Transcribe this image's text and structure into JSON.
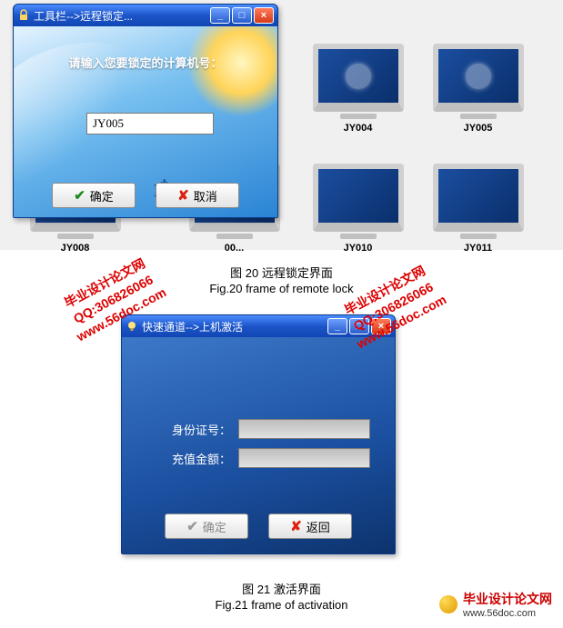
{
  "dialog1": {
    "title": "工具栏-->远程锁定...",
    "prompt": "请输入您要锁定的计算机号：",
    "input_value": "JY005",
    "ok_label": "确定",
    "cancel_label": "取消"
  },
  "dialog2": {
    "title": "快速通道-->上机激活",
    "id_label": "身份证号：",
    "amount_label": "充值金额：",
    "id_value": "",
    "amount_value": "",
    "ok_label": "确定",
    "back_label": "返回"
  },
  "desktop": {
    "pc_09": "JY004",
    "pc_10": "JY005",
    "pc_13": "JY008",
    "pc_14": "00...",
    "pc_15": "JY010",
    "pc_16": "JY011"
  },
  "captions": {
    "fig20_cn": "图 20    远程锁定界面",
    "fig20_en": "Fig.20    frame of remote lock",
    "fig21_cn": "图 21    激活界面",
    "fig21_en": "Fig.21    frame of activation"
  },
  "watermark": {
    "line1": "毕业设计论文网",
    "line2": "QQ:306826066",
    "line3": "www.56doc.com"
  },
  "footer": {
    "brand": "毕业设计论文网",
    "url": "www.56doc.com"
  },
  "icons": {
    "lock": "lock-icon",
    "bulb": "bulb-icon",
    "min": "_",
    "max": "□",
    "close": "×",
    "check": "✔",
    "x": "✘"
  }
}
